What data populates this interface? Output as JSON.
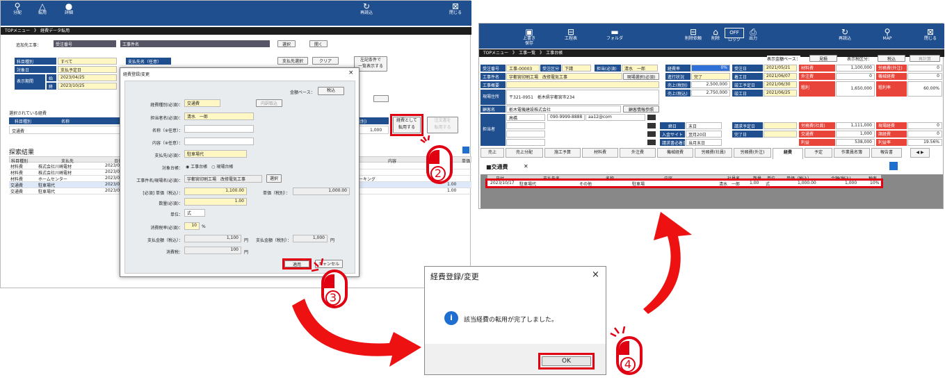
{
  "left": {
    "toolbar": {
      "btn1": "分配",
      "btn2": "転用",
      "btn3": "詳細",
      "btn4": "再読込",
      "btn5": "閉じる"
    },
    "breadcrumb": {
      "root": "TOPメニュー",
      "sep": "》",
      "page": "経費データ転用"
    },
    "dest": {
      "label": "追加先工事：",
      "f1": "受注番号",
      "f2": "工事件名",
      "select": "選択",
      "open": "開く"
    },
    "filter": {
      "category_label": "科目種別",
      "category_value": "すべて",
      "target_label": "対象日",
      "target_value": "支払予定日",
      "period_label": "表示期間",
      "start_label": "始",
      "start": "2023/04/25",
      "end_label": "終",
      "end": "2023/10/25",
      "payee_label": "支払先名（任意）",
      "payee_select": "支払先選択",
      "clear": "クリア",
      "show_list": "左記条件で\n一覧表示する"
    },
    "selected": {
      "title": "選択されている経費",
      "col1": "科目種別",
      "col2": "名称",
      "col3": "税別)",
      "row_cat": "交通費",
      "row_amt": "1,000",
      "transfer": "経費として\n転用する",
      "order": "注文書を\n転用する"
    },
    "results": {
      "title": "探索結果",
      "cols": [
        "科目種別",
        "支払先",
        "日付",
        "内容",
        "単価"
      ],
      "rows": [
        [
          "材料費",
          "株式会社川崎電材",
          "2023/07",
          "",
          ""
        ],
        [
          "材料費",
          "株式会社川崎電材",
          "2023/07",
          "",
          ""
        ],
        [
          "材料費",
          "ホームセンター",
          "2023/07",
          "コーキング",
          ""
        ],
        [
          "交通費",
          "駐車場代",
          "2023/07",
          "",
          "1.00"
        ],
        [
          "交通費",
          "駐車場代",
          "2023/07",
          "",
          "1.00"
        ]
      ]
    }
  },
  "dialog": {
    "title": "経費登録/変更",
    "close": "×",
    "base_label": "金額ベース：",
    "base_value": "税込",
    "type_label": "経費種別(必須)：",
    "type_value": "交通費",
    "detail_btn": "内訳取込",
    "person_label": "担当者名(必須)：",
    "person_value": "清水　一郎",
    "name_label": "名称（※任意）：",
    "content_label": "内容（※任意）：",
    "payee_label": "支払先(必須)：",
    "payee_value": "駐車場代",
    "ledger_label": "対象台帳：",
    "ledger_opt1": "工事台帳",
    "ledger_opt2": "現場台帳",
    "site_label": "工事件名/現場名(必須)：",
    "site_value": "宇都宮印刷工場　改修電気工事",
    "site_select": "選択",
    "price_label": "[必須] 単価（税込）：",
    "price_value": "1,100.00",
    "price_ex_label": "単価（税別）：",
    "price_ex_value": "1,000.00",
    "qty_label": "数量(必須)：",
    "qty_value": "1.00",
    "unit_label": "単位：",
    "unit_value": "式",
    "tax_label": "消費税率(必須)：",
    "tax_value": "10",
    "tax_unit": "%",
    "pay_in_label": "支払金額（税込）：",
    "pay_in_value": "1,100",
    "yen": "円",
    "pay_ex_label": "支払金額（税別）：",
    "pay_ex_value": "1,000",
    "ctax_label": "消費税：",
    "ctax_value": "100",
    "apply": "適用",
    "cancel": "キャンセル"
  },
  "confirm": {
    "title": "経費登録/変更",
    "close": "×",
    "message": "該当経費の転用が完了しました。",
    "ok": "OK",
    "info": "i"
  },
  "right": {
    "toolbar": [
      "上書き\n保存",
      "工程表",
      "フォルダ",
      "削除依頼",
      "削除",
      "ロック",
      "出力",
      "再読込",
      "MAP",
      "閉じる"
    ],
    "off": "OFF",
    "breadcrumb": {
      "root": "TOPメニュー",
      "sep1": "》",
      "mid": "工事一覧",
      "sep2": "》",
      "page": "工事台帳"
    },
    "info": {
      "order_no_label": "受注番号",
      "order_no": "工事-00003",
      "order_type_label": "受注区分",
      "order_type": "下請",
      "person_label": "担当(必須)",
      "person": "清水　一郎",
      "name_label": "工事件名",
      "name": "宇都宮印刷工場　改修電気工事",
      "site_select": "現場選択(必須)",
      "status_label": "工事概要",
      "addr_label": "現場住所",
      "addr": "〒321-0951　栃木県宇都宮市234",
      "client_label": "顧客名",
      "client": "栃木電機建設株式会社",
      "client_btn": "顧客情報参照",
      "staff_label": "担当者",
      "staff_name": "高橋",
      "staff_tel": "090-9999-8888",
      "staff_mail": "aa12@com",
      "cutoff_label": "締日",
      "cutoff": "末日",
      "pay_cycle_label": "入金サイト",
      "pay_cycle": "翌月20日",
      "bill_label": "請求書必着日",
      "bill": "当月末日"
    },
    "finance": {
      "base_label": "表示金額ベース：",
      "base_btn": "見積",
      "type_label": "表示税区分：",
      "type_btn": "税込",
      "recalc": "再計算",
      "rate_label": "経費率",
      "rate": "0%",
      "progress_label": "進行状況",
      "progress": "完了",
      "sales_ex_label": "売上(税別)",
      "sales_ex": "2,500,000",
      "sales_in_label": "売上(税込)",
      "sales_in": "2,750,000",
      "dates": [
        [
          "受注日",
          "2021/05/21"
        ],
        [
          "着工日",
          "2021/06/07"
        ],
        [
          "竣工予定日",
          "2021/06/30"
        ],
        [
          "竣工日",
          "2021/06/25"
        ]
      ],
      "bill_date_label": "請求予定日",
      "done_label": "完了日",
      "costs": [
        [
          "材料費",
          "1,100,000",
          "労務費(外注)",
          "0"
        ],
        [
          "外注費",
          "0",
          "機械経費",
          "0"
        ],
        [
          "粗利",
          "1,650,000",
          "粗利率",
          "60.00%"
        ],
        [
          "労務費(社員)",
          "1,111,000",
          "現場経費",
          "0"
        ],
        [
          "交通費",
          "1,000",
          "諸経費",
          "0"
        ],
        [
          "利益",
          "538,000",
          "利益率",
          "19.56%"
        ]
      ]
    },
    "tabs": [
      "売上",
      "売上分配",
      "施工予算",
      "材料費",
      "外注費",
      "機械経費",
      "労務費(社員)",
      "労務費(外注)",
      "経費",
      "予定",
      "作業員名簿",
      "報告書"
    ],
    "active_tab": "経費",
    "expense": {
      "title": "■交通費",
      "cols": [
        "日付",
        "支払先名",
        "名称",
        "内容",
        "社員名",
        "数量",
        "単位",
        "単価（税込）",
        "金額(税込)",
        "税率"
      ],
      "row": [
        "2023/10/17",
        "駐車場代",
        "その他",
        "駐車場",
        "清水　一郎",
        "1.00",
        "式",
        "1,000.00",
        "1,000",
        "10%"
      ]
    }
  },
  "steps": [
    "2",
    "3",
    "4"
  ],
  "colors": {
    "accent": "#1f4f8f",
    "highlight": "#e00012",
    "arrow": "#ee1111"
  }
}
